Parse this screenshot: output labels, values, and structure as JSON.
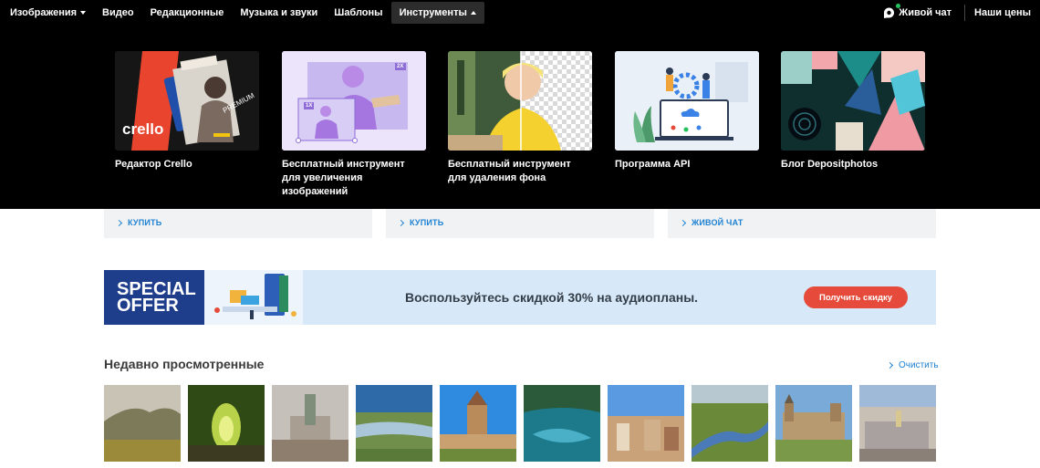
{
  "nav": {
    "items": [
      {
        "label": "Изображения",
        "caret": "down"
      },
      {
        "label": "Видео"
      },
      {
        "label": "Редакционные"
      },
      {
        "label": "Музыка и звуки"
      },
      {
        "label": "Шаблоны"
      },
      {
        "label": "Инструменты",
        "caret": "up",
        "active": true
      }
    ],
    "live_chat": "Живой чат",
    "prices": "Наши цены",
    "online_color": "#21c35b"
  },
  "tools": [
    {
      "label": "Редактор Crello",
      "thumb_text": "crello",
      "badge": "PREMIUM"
    },
    {
      "label": "Бесплатный инструмент для увеличения изображений",
      "badge_2x": "2X",
      "badge_1x": "1X"
    },
    {
      "label": "Бесплатный инструмент для удаления фона"
    },
    {
      "label": "Программа API"
    },
    {
      "label": "Блог Depositphotos"
    }
  ],
  "cards": [
    {
      "link": "КУПИТЬ"
    },
    {
      "link": "КУПИТЬ"
    },
    {
      "link": "ЖИВОЙ ЧАТ"
    }
  ],
  "banner": {
    "offer_line1": "SPECIAL",
    "offer_line2": "OFFER",
    "text": "Воспользуйтесь скидкой 30% на аудиопланы.",
    "button": "Получить скидку",
    "button_color": "#e54a3a"
  },
  "recent": {
    "title": "Недавно просмотренные",
    "clear": "Очистить",
    "thumbs": [
      {
        "icon": "mountain-landscape"
      },
      {
        "icon": "green-tunnel"
      },
      {
        "icon": "city-church"
      },
      {
        "icon": "river-valley"
      },
      {
        "icon": "fortress-tower"
      },
      {
        "icon": "forest-lake"
      },
      {
        "icon": "old-town"
      },
      {
        "icon": "river-aerial"
      },
      {
        "icon": "castle"
      },
      {
        "icon": "city-coast"
      }
    ]
  }
}
